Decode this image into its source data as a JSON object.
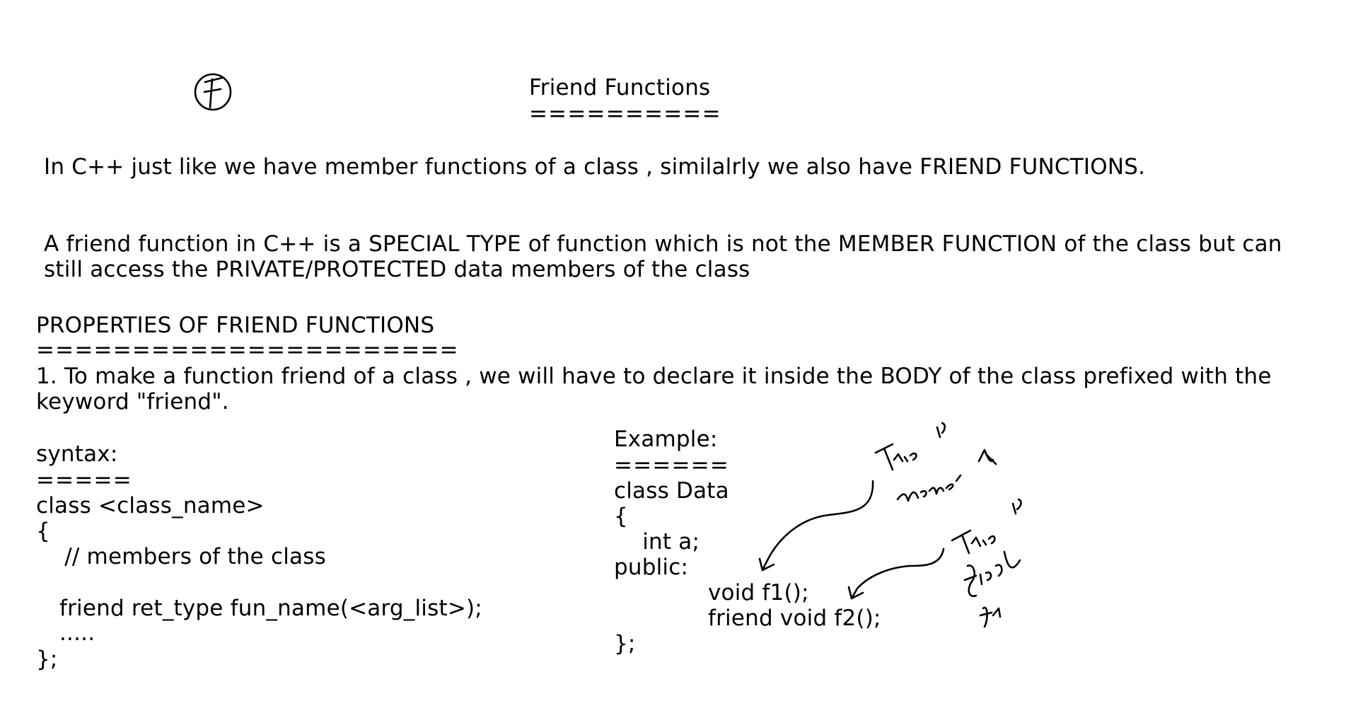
{
  "title": {
    "text": "Friend Functions",
    "underline": "=========="
  },
  "intro": {
    "line1": "In C++ just like we have member functions of a class , similalrly we also have FRIEND FUNCTIONS.",
    "def_line1": "A friend function in C++ is a SPECIAL TYPE of function which is not the MEMBER FUNCTION of the class but can",
    "def_line2": "still access the PRIVATE/PROTECTED data members of the class"
  },
  "properties": {
    "heading": "PROPERTIES OF FRIEND FUNCTIONS",
    "underline": "======================",
    "item1_line1": "1. To make a function friend of a class , we will have to declare it inside the BODY of the class prefixed with the",
    "item1_line2": "keyword \"friend\"."
  },
  "syntax": {
    "label": "syntax:",
    "underline": "=====",
    "lines": [
      "class <class_name>",
      "{",
      "    // members of the class",
      "friend ret_type fun_name(<arg_list>);",
      ".....",
      "};"
    ]
  },
  "example": {
    "label": "Example:",
    "underline": "======",
    "lines": [
      "class Data",
      "{",
      "    int a;",
      "public:",
      "void f1();",
      "friend void f2();",
      "};"
    ]
  },
  "annotations": {
    "circle_mark": "F",
    "note_member": "This is member fn",
    "note_friend": "This is friend fn"
  }
}
